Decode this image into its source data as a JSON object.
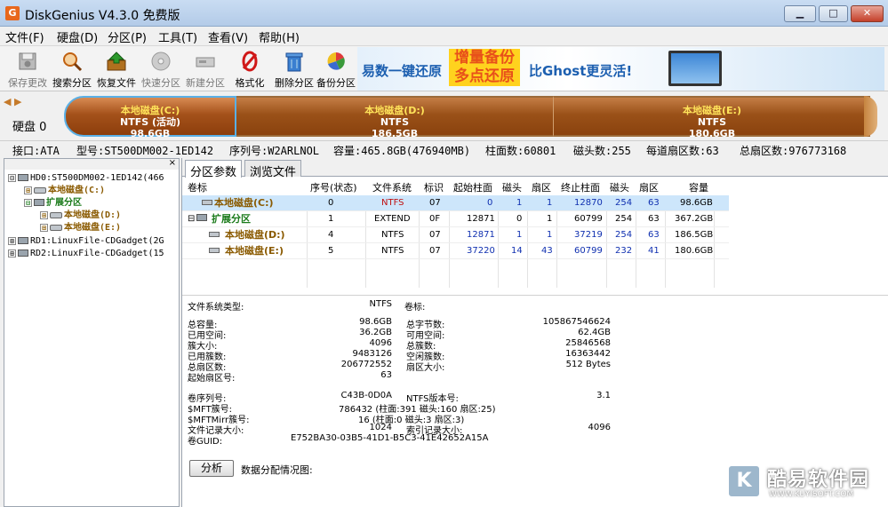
{
  "window": {
    "title": "DiskGenius V4.3.0 免费版",
    "app_icon_letter": "G",
    "min_label": "▁",
    "max_label": "□",
    "close_label": "✕"
  },
  "menu": [
    "文件(F)",
    "硬盘(D)",
    "分区(P)",
    "工具(T)",
    "查看(V)",
    "帮助(H)"
  ],
  "toolbar": [
    {
      "label": "保存更改",
      "icon": "save-icon",
      "enabled": false
    },
    {
      "label": "搜索分区",
      "icon": "magnifier-icon",
      "enabled": true
    },
    {
      "label": "恢复文件",
      "icon": "recover-icon",
      "enabled": true
    },
    {
      "label": "快速分区",
      "icon": "quick-partition-icon",
      "enabled": false
    },
    {
      "label": "新建分区",
      "icon": "new-partition-icon",
      "enabled": false
    },
    {
      "label": "格式化",
      "icon": "format-icon",
      "enabled": true
    },
    {
      "label": "删除分区",
      "icon": "trash-icon",
      "enabled": true
    },
    {
      "label": "备份分区",
      "icon": "backup-icon",
      "enabled": true
    }
  ],
  "banner": {
    "text1": "易数一键还原",
    "text2a": "增量备份",
    "text2b": "多点还原",
    "text3": "比Ghost更灵活!"
  },
  "diskbar": {
    "nav": "◀ ▶",
    "disk_label": "硬盘 0",
    "segments": [
      {
        "name": "本地磁盘(C:)",
        "fs": "NTFS (活动)",
        "size": "98.6GB"
      },
      {
        "name": "本地磁盘(D:)",
        "fs": "NTFS",
        "size": "186.5GB"
      },
      {
        "name": "本地磁盘(E:)",
        "fs": "NTFS",
        "size": "180.6GB"
      }
    ]
  },
  "infoline": {
    "interface": "接口:ATA",
    "model": "型号:ST500DM002-1ED142",
    "serial": "序列号:W2ARLNOL",
    "capacity": "容量:465.8GB(476940MB)",
    "cylinders": "柱面数:60801",
    "heads": "磁头数:255",
    "sectors_per_track": "每道扇区数:63",
    "total_sectors": "总扇区数:976773168"
  },
  "tree": {
    "close": "×",
    "items": [
      {
        "text": "HD0:ST500DM002-1ED142(466",
        "kind": "disk",
        "toggle": "⊟"
      },
      {
        "text": "本地磁盘(C:)",
        "kind": "vol",
        "toggle": "⊞"
      },
      {
        "text": "扩展分区",
        "kind": "ext",
        "toggle": "⊟"
      },
      {
        "text": "本地磁盘(D:)",
        "kind": "vol",
        "toggle": "⊞"
      },
      {
        "text": "本地磁盘(E:)",
        "kind": "vol",
        "toggle": "⊞"
      },
      {
        "text": "RD1:LinuxFile-CDGadget(2G",
        "kind": "disk",
        "toggle": "⊞"
      },
      {
        "text": "RD2:LinuxFile-CDGadget(15",
        "kind": "disk",
        "toggle": "⊞"
      }
    ]
  },
  "tabs": [
    "分区参数",
    "浏览文件"
  ],
  "partition_table": {
    "headers": [
      "卷标",
      "序号(状态)",
      "文件系统",
      "标识",
      "起始柱面",
      "磁头",
      "扇区",
      "终止柱面",
      "磁头",
      "扇区",
      "容量"
    ],
    "rows": [
      {
        "name": "本地磁盘(C:)",
        "index": "0",
        "fs": "NTFS",
        "id": "07",
        "start_cyl": "0",
        "start_head": "1",
        "start_sec": "1",
        "end_cyl": "12870",
        "end_head": "254",
        "end_sec": "63",
        "capacity": "98.6GB"
      },
      {
        "name": "扩展分区",
        "index": "1",
        "fs": "EXTEND",
        "id": "0F",
        "start_cyl": "12871",
        "start_head": "0",
        "start_sec": "1",
        "end_cyl": "60799",
        "end_head": "254",
        "end_sec": "63",
        "capacity": "367.2GB"
      },
      {
        "name": "本地磁盘(D:)",
        "index": "4",
        "fs": "NTFS",
        "id": "07",
        "start_cyl": "12871",
        "start_head": "1",
        "start_sec": "1",
        "end_cyl": "37219",
        "end_head": "254",
        "end_sec": "63",
        "capacity": "186.5GB"
      },
      {
        "name": "本地磁盘(E:)",
        "index": "5",
        "fs": "NTFS",
        "id": "07",
        "start_cyl": "37220",
        "start_head": "14",
        "start_sec": "43",
        "end_cyl": "60799",
        "end_head": "232",
        "end_sec": "41",
        "capacity": "180.6GB"
      }
    ]
  },
  "details": {
    "fs_type_label": "文件系统类型:",
    "fs_type": "NTFS",
    "volume_label_label": "卷标:",
    "total_capacity_label": "总容量:",
    "total_capacity": "98.6GB",
    "total_bytes_label": "总字节数:",
    "total_bytes": "105867546624",
    "used_label": "已用空间:",
    "used": "36.2GB",
    "free_label": "可用空间:",
    "free": "62.4GB",
    "cluster_size_label": "簇大小:",
    "cluster_size": "4096",
    "total_clusters_label": "总簇数:",
    "total_clusters": "25846568",
    "used_clusters_label": "已用簇数:",
    "used_clusters": "9483126",
    "free_clusters_label": "空闲簇数:",
    "free_clusters": "16363442",
    "total_sectors_label": "总扇区数:",
    "total_sectors": "206772552",
    "sector_size_label": "扇区大小:",
    "sector_size": "512 Bytes",
    "start_sector_label": "起始扇区号:",
    "start_sector": "63",
    "serial_label": "卷序列号:",
    "serial": "C43B-0D0A",
    "ntfs_ver_label": "NTFS版本号:",
    "ntfs_ver": "3.1",
    "mft_label": "$MFT簇号:",
    "mft": "786432 (柱面:391 磁头:160 扇区:25)",
    "mftmirr_label": "$MFTMirr簇号:",
    "mftmirr": "16 (柱面:0 磁头:3 扇区:3)",
    "record_size_label": "文件记录大小:",
    "record_size": "1024",
    "index_size_label": "索引记录大小:",
    "index_size": "4096",
    "guid_label": "卷GUID:",
    "guid": "E752BA30-03B5-41D1-B5C3-41E42652A15A"
  },
  "analyze": {
    "button": "分析",
    "label": "数据分配情况图:"
  },
  "watermark": {
    "logo": "K",
    "text": "酷易软件园",
    "url": "WWW.KUYISOFT.COM"
  }
}
